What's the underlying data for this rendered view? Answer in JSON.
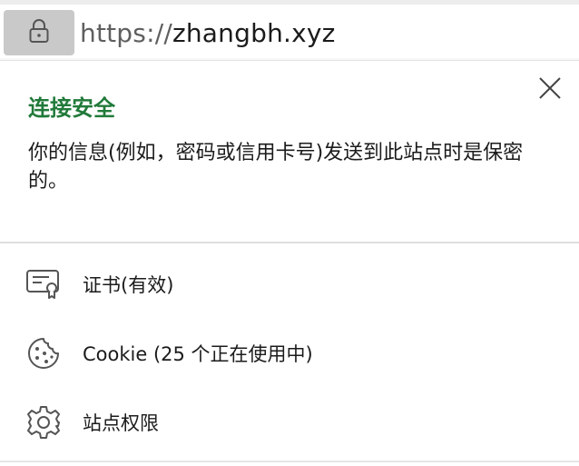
{
  "address_bar": {
    "lock_icon": "lock-icon",
    "url_scheme": "https://",
    "url_host": "zhangbh.xyz"
  },
  "site_info_panel": {
    "close_icon": "close-icon",
    "title": "连接安全",
    "description": "你的信息(例如，密码或信用卡号)发送到此站点时是保密的。",
    "items": [
      {
        "icon": "certificate-icon",
        "label": "证书(有效)"
      },
      {
        "icon": "cookie-icon",
        "label": "Cookie (25 个正在使用中)"
      },
      {
        "icon": "gear-icon",
        "label": "站点权限"
      }
    ]
  },
  "colors": {
    "secure_green": "#217a3a",
    "lock_button_bg": "#c9c9c9",
    "text": "#1b1b1b",
    "icon_stroke": "#555555"
  }
}
